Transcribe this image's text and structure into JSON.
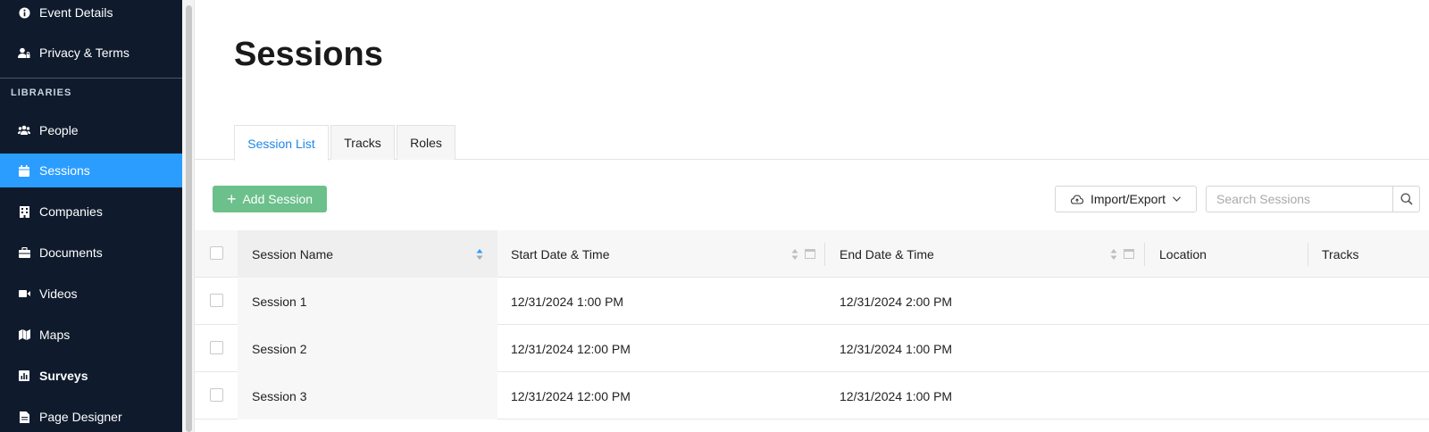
{
  "sidebar": {
    "top_items": [
      {
        "label": "Event Details",
        "icon": "info-icon"
      },
      {
        "label": "Privacy & Terms",
        "icon": "user-lock-icon"
      }
    ],
    "section_label": "LIBRARIES",
    "items": [
      {
        "label": "People",
        "icon": "people-icon"
      },
      {
        "label": "Sessions",
        "icon": "calendar-icon",
        "active": true
      },
      {
        "label": "Companies",
        "icon": "building-icon"
      },
      {
        "label": "Documents",
        "icon": "briefcase-icon"
      },
      {
        "label": "Videos",
        "icon": "video-icon"
      },
      {
        "label": "Maps",
        "icon": "map-icon"
      },
      {
        "label": "Surveys",
        "icon": "chart-icon"
      },
      {
        "label": "Page Designer",
        "icon": "page-icon"
      }
    ]
  },
  "page": {
    "title": "Sessions"
  },
  "tabs": [
    {
      "label": "Session List",
      "active": true
    },
    {
      "label": "Tracks"
    },
    {
      "label": "Roles"
    }
  ],
  "toolbar": {
    "add_label": "Add Session",
    "import_label": "Import/Export",
    "search_placeholder": "Search Sessions"
  },
  "table": {
    "columns": [
      "Session Name",
      "Start Date & Time",
      "End Date & Time",
      "Location",
      "Tracks"
    ],
    "rows": [
      {
        "name": "Session 1",
        "start": "12/31/2024 1:00 PM",
        "end": "12/31/2024 2:00 PM",
        "location": "",
        "tracks": ""
      },
      {
        "name": "Session 2",
        "start": "12/31/2024 12:00 PM",
        "end": "12/31/2024 1:00 PM",
        "location": "",
        "tracks": ""
      },
      {
        "name": "Session 3",
        "start": "12/31/2024 12:00 PM",
        "end": "12/31/2024 1:00 PM",
        "location": "",
        "tracks": ""
      }
    ]
  },
  "colors": {
    "sidebar_bg": "#0f1b2d",
    "active": "#2a9dff",
    "add_button": "#6cc08b",
    "tab_active_text": "#1e88e5"
  }
}
